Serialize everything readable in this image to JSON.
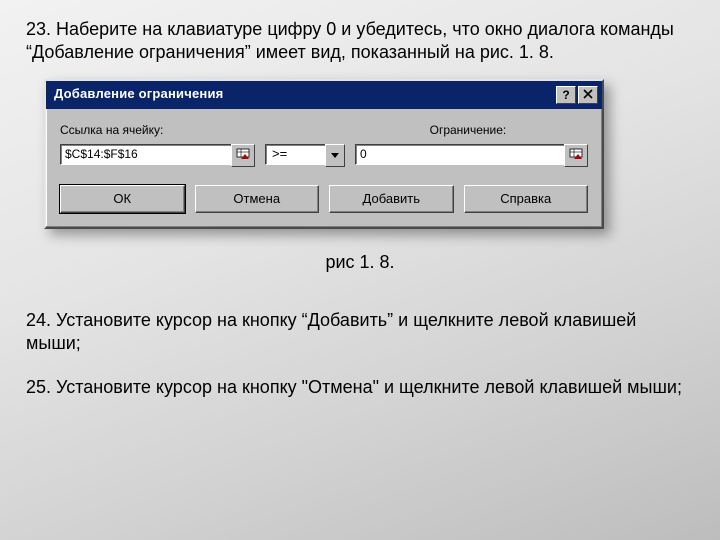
{
  "intro": "23. Наберите на клавиатуре цифру 0 и убедитесь, что окно диалога команды “Добавление ограничения” имеет вид, показанный на рис. 1. 8.",
  "dialog": {
    "title": "Добавление ограничения",
    "labels": {
      "cellRef": "Ссылка на ячейку:",
      "constraint": "Ограничение:"
    },
    "fields": {
      "cellRef": "$C$14:$F$16",
      "operator": ">=",
      "constraint": "0"
    },
    "buttons": {
      "ok": "ОК",
      "cancel": "Отмена",
      "add": "Добавить",
      "help": "Справка"
    },
    "titleButtons": {
      "help": "?",
      "close": "×"
    }
  },
  "figureCaption": "рис 1. 8.",
  "step24": "24. Установите курсор на кнопку “Добавить” и щелкните левой клавишей мыши;",
  "step25": "25. Установите курсор на кнопку \"Отмена\" и щелкните левой клавишей мыши;"
}
